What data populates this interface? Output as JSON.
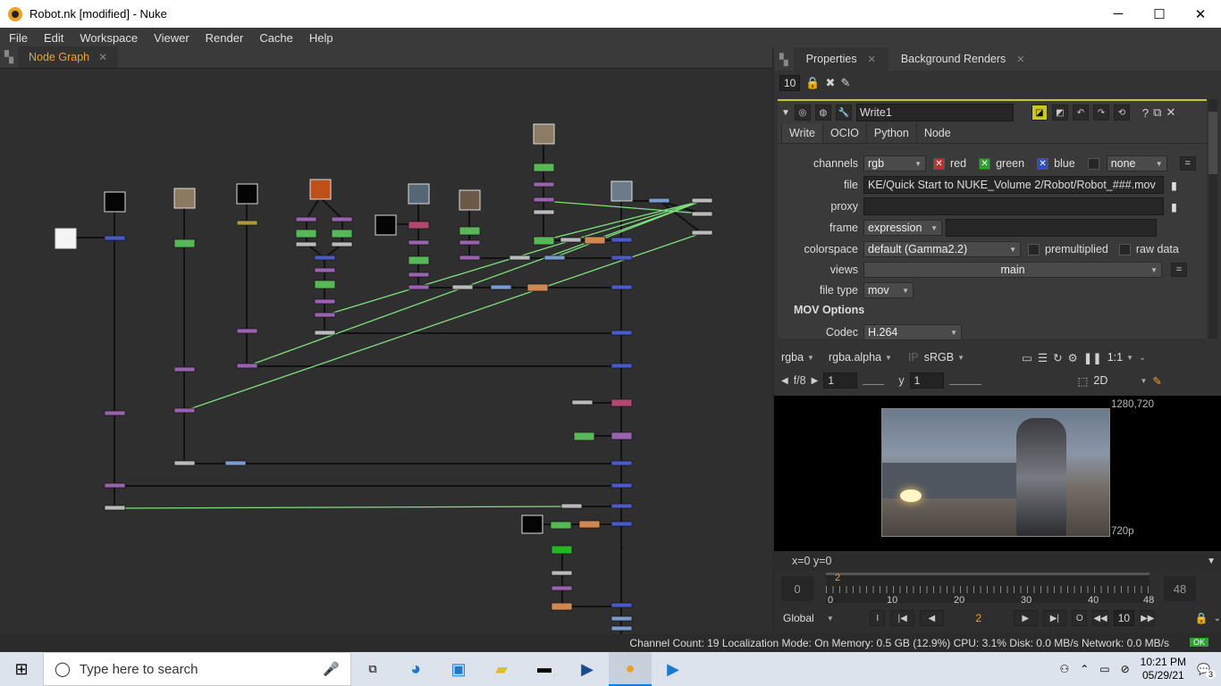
{
  "window": {
    "title": "Robot.nk [modified] - Nuke",
    "minimize": "─",
    "maximize": "☐",
    "close": "✕"
  },
  "menu": [
    "File",
    "Edit",
    "Workspace",
    "Viewer",
    "Render",
    "Cache",
    "Help"
  ],
  "left_pane": {
    "tab": "Node Graph",
    "tab_close": "✕"
  },
  "right_pane": {
    "tabs": [
      {
        "label": "Properties",
        "close": "✕"
      },
      {
        "label": "Background Renders",
        "close": "✕"
      }
    ],
    "max_panels": "10",
    "node": {
      "name": "Write1",
      "tabs": [
        "Write",
        "OCIO",
        "Python",
        "Node"
      ],
      "channels_label": "channels",
      "channels": "rgb",
      "red": "red",
      "green": "green",
      "blue": "blue",
      "extra_channel": "none",
      "file_label": "file",
      "file": "KE/Quick Start to NUKE_Volume 2/Robot/Robot_###.mov",
      "proxy_label": "proxy",
      "proxy": "",
      "frame_label": "frame",
      "frame": "expression",
      "colorspace_label": "colorspace",
      "colorspace": "default (Gamma2.2)",
      "premultiplied": "premultiplied",
      "raw_data": "raw data",
      "views_label": "views",
      "views": "main",
      "file_type_label": "file type",
      "file_type": "mov",
      "mov_options": "MOV Options",
      "codec_label": "Codec",
      "codec": "H.264",
      "equals": "="
    }
  },
  "viewer": {
    "channel_set": "rgba",
    "alpha_channel": "rgba.alpha",
    "ip": "IP",
    "lut": "sRGB",
    "zoom": "1:1",
    "fstop": "f/8",
    "gain": "1",
    "gamma_label": "y",
    "gamma": "1",
    "mode": "2D",
    "format_label": "1280,720",
    "format_name": "720p",
    "coords": "x=0 y=0"
  },
  "timeline": {
    "start": "0",
    "end": "48",
    "marker": "2",
    "ticks": [
      "0",
      "10",
      "20",
      "30",
      "40",
      "48"
    ],
    "scope": "Global",
    "frame": "2",
    "increment": "10",
    "in_btn": "I",
    "out_btn": "O"
  },
  "statusline": "Channel Count: 19  Localization Mode: On  Memory: 0.5 GB (12.9%)  CPU: 3.1%  Disk: 0.0 MB/s  Network: 0.0 MB/s",
  "status_ok": "OK",
  "taskbar": {
    "search_placeholder": "Type here to search",
    "time": "10:21 PM",
    "date": "05/29/21",
    "notifications": "3"
  }
}
